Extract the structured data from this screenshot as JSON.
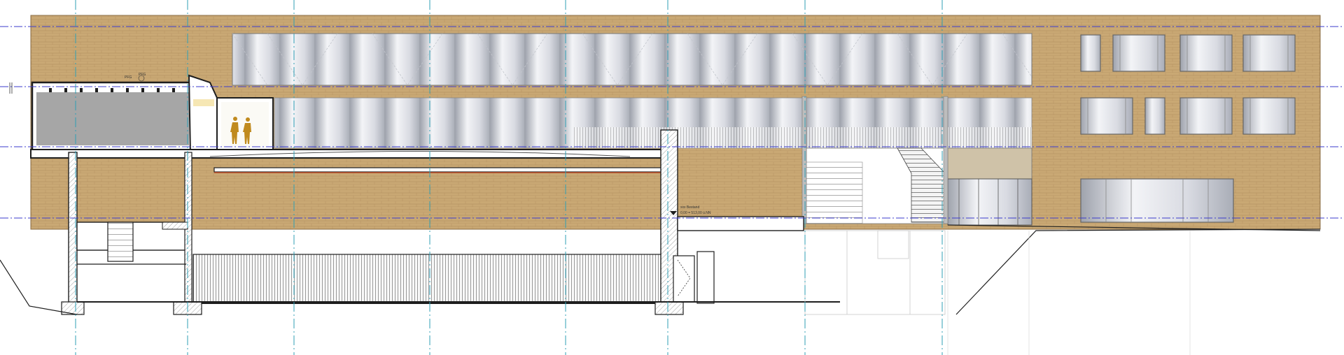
{
  "drawing": {
    "annotations": {
      "roof_tag": "PFG",
      "roof_tag_2": "PFG",
      "level_title": "xxx Bestand",
      "level_value": "0,00 = 513,00 ü.NN"
    },
    "colors": {
      "brick": "#c9a874",
      "brick_dark": "#b58f5a",
      "glass_light": "#f1f2f6",
      "glass_mid": "#a9acb6",
      "axis_cyan": "#2f9fb5",
      "level_blue": "#3b3bcc",
      "section_gray": "#a6a6a6",
      "figure_ochre": "#c08a1e",
      "wall_black": "#1e1e1e"
    }
  }
}
